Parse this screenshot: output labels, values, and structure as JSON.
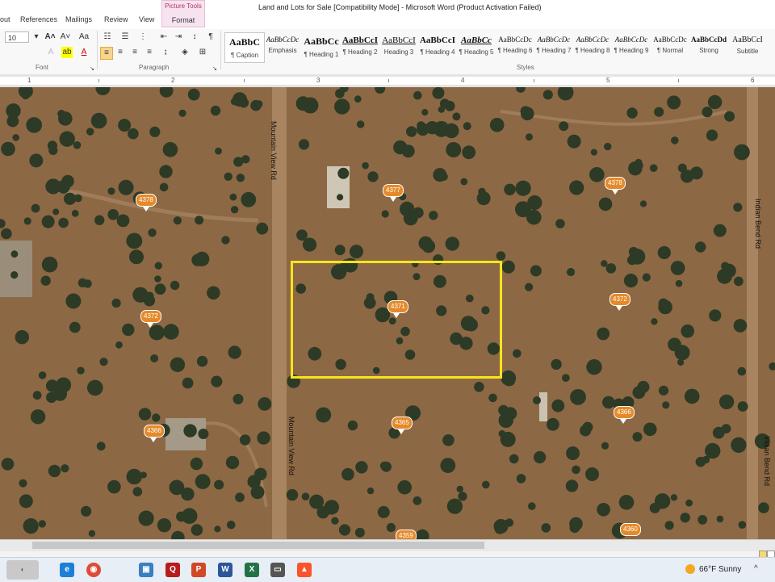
{
  "titlebar": {
    "doc_title": "Land and Lots for Sale [Compatibility Mode]  -  Microsoft Word (Product Activation Failed)",
    "tabs": [
      "out",
      "References",
      "Mailings",
      "Review",
      "View"
    ],
    "picture_tools": {
      "label": "Picture Tools",
      "format_tab": "Format"
    }
  },
  "ribbon": {
    "font_size": "10",
    "font_group_label": "Font",
    "paragraph_group_label": "Paragraph",
    "styles_group_label": "Styles",
    "styles": [
      {
        "sample": "AaBbC",
        "name": "¶ Caption"
      },
      {
        "sample": "AaBbCcDc",
        "name": "Emphasis"
      },
      {
        "sample": "AaBbCc",
        "name": "¶ Heading 1"
      },
      {
        "sample": "AaBbCcI",
        "name": "¶ Heading 2"
      },
      {
        "sample": "AaBbCcI",
        "name": "Heading 3"
      },
      {
        "sample": "AaBbCcI",
        "name": "¶ Heading 4"
      },
      {
        "sample": "AaBbCc",
        "name": "¶ Heading 5"
      },
      {
        "sample": "AaBbCcDc",
        "name": "¶ Heading 6"
      },
      {
        "sample": "AaBbCcDc",
        "name": "¶ Heading 7"
      },
      {
        "sample": "AaBbCcDc",
        "name": "¶ Heading 8"
      },
      {
        "sample": "AaBbCcDc",
        "name": "¶ Heading 9"
      },
      {
        "sample": "AaBbCcDc",
        "name": "¶ Normal"
      },
      {
        "sample": "AaBbCcDd",
        "name": "Strong"
      },
      {
        "sample": "AaBbCcI",
        "name": "Subtitle"
      }
    ]
  },
  "ruler": {
    "numbers": [
      "1",
      "2",
      "3",
      "4",
      "5",
      "6"
    ]
  },
  "map": {
    "roads": [
      "Mountain View Rd",
      "Mountain View Rd",
      "Indian Bend Rd",
      "Indian Bend Rd"
    ],
    "parcels": [
      "4378",
      "4377",
      "4378",
      "4372",
      "4371",
      "4372",
      "4365",
      "4366",
      "4366",
      "4359",
      "4360"
    ],
    "highlight_color": "#f7e51a"
  },
  "taskbar": {
    "weather": "66°F  Sunny",
    "apps": [
      "edge-icon",
      "chrome-icon",
      "photos-icon",
      "adobe-icon",
      "powerpoint-icon",
      "word-icon",
      "excel-icon",
      "remote-icon",
      "brave-icon"
    ]
  }
}
